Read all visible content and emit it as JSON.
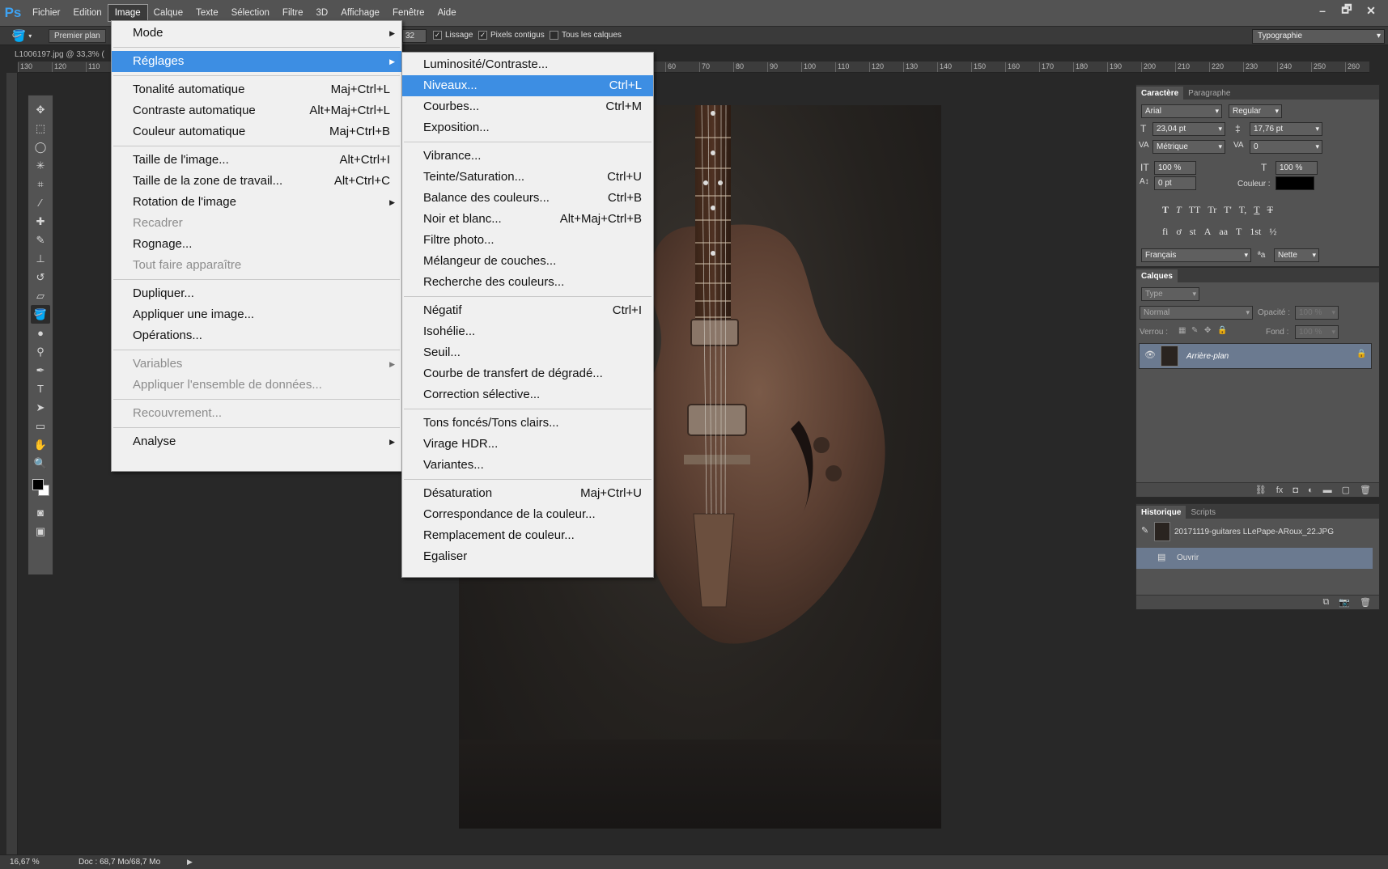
{
  "app": {
    "logo": "Ps",
    "menu": [
      "Fichier",
      "Edition",
      "Image",
      "Calque",
      "Texte",
      "Sélection",
      "Filtre",
      "3D",
      "Affichage",
      "Fenêtre",
      "Aide"
    ],
    "window_controls": [
      "–",
      "🗗",
      "✕"
    ]
  },
  "options": {
    "fill_source": "Premier plan",
    "tolerance": "32",
    "lissage": "Lissage",
    "pixels_contigus": "Pixels contigus",
    "tous_les_calques": "Tous les calques",
    "workspace": "Typographie"
  },
  "document": {
    "tab_title": "L1006197.jpg @ 33,3% (",
    "ruler_top": [
      "130",
      "120",
      "110",
      "60",
      "70",
      "80",
      "90",
      "100",
      "110",
      "120",
      "130",
      "140",
      "150",
      "160",
      "170",
      "180",
      "190",
      "200",
      "210",
      "220",
      "230",
      "240",
      "250",
      "260"
    ]
  },
  "image_menu": {
    "items": [
      {
        "label": "Mode",
        "shortcut": "",
        "submenu": true,
        "disabled": false
      },
      {
        "sep": true
      },
      {
        "label": "Réglages",
        "shortcut": "",
        "submenu": true,
        "disabled": false,
        "highlight": true
      },
      {
        "sep": true
      },
      {
        "label": "Tonalité automatique",
        "shortcut": "Maj+Ctrl+L"
      },
      {
        "label": "Contraste automatique",
        "shortcut": "Alt+Maj+Ctrl+L"
      },
      {
        "label": "Couleur automatique",
        "shortcut": "Maj+Ctrl+B"
      },
      {
        "sep": true
      },
      {
        "label": "Taille de l'image...",
        "shortcut": "Alt+Ctrl+I"
      },
      {
        "label": "Taille de la zone de travail...",
        "shortcut": "Alt+Ctrl+C"
      },
      {
        "label": "Rotation de l'image",
        "shortcut": "",
        "submenu": true
      },
      {
        "label": "Recadrer",
        "shortcut": "",
        "disabled": true
      },
      {
        "label": "Rognage...",
        "shortcut": ""
      },
      {
        "label": "Tout faire apparaître",
        "shortcut": "",
        "disabled": true
      },
      {
        "sep": true
      },
      {
        "label": "Dupliquer...",
        "shortcut": ""
      },
      {
        "label": "Appliquer une image...",
        "shortcut": ""
      },
      {
        "label": "Opérations...",
        "shortcut": ""
      },
      {
        "sep": true
      },
      {
        "label": "Variables",
        "shortcut": "",
        "submenu": true,
        "disabled": true
      },
      {
        "label": "Appliquer l'ensemble de données...",
        "shortcut": "",
        "disabled": true
      },
      {
        "sep": true
      },
      {
        "label": "Recouvrement...",
        "shortcut": "",
        "disabled": true
      },
      {
        "sep": true
      },
      {
        "label": "Analyse",
        "shortcut": "",
        "submenu": true
      }
    ]
  },
  "adjust_menu": {
    "items": [
      {
        "label": "Luminosité/Contraste...",
        "shortcut": ""
      },
      {
        "label": "Niveaux...",
        "shortcut": "Ctrl+L",
        "highlight": true
      },
      {
        "label": "Courbes...",
        "shortcut": "Ctrl+M"
      },
      {
        "label": "Exposition...",
        "shortcut": ""
      },
      {
        "sep": true
      },
      {
        "label": "Vibrance...",
        "shortcut": ""
      },
      {
        "label": "Teinte/Saturation...",
        "shortcut": "Ctrl+U"
      },
      {
        "label": "Balance des couleurs...",
        "shortcut": "Ctrl+B"
      },
      {
        "label": "Noir et blanc...",
        "shortcut": "Alt+Maj+Ctrl+B"
      },
      {
        "label": "Filtre photo...",
        "shortcut": ""
      },
      {
        "label": "Mélangeur de couches...",
        "shortcut": ""
      },
      {
        "label": "Recherche des couleurs...",
        "shortcut": ""
      },
      {
        "sep": true
      },
      {
        "label": "Négatif",
        "shortcut": "Ctrl+I"
      },
      {
        "label": "Isohélie...",
        "shortcut": ""
      },
      {
        "label": "Seuil...",
        "shortcut": ""
      },
      {
        "label": "Courbe de transfert de dégradé...",
        "shortcut": ""
      },
      {
        "label": "Correction sélective...",
        "shortcut": ""
      },
      {
        "sep": true
      },
      {
        "label": "Tons foncés/Tons clairs...",
        "shortcut": ""
      },
      {
        "label": "Virage HDR...",
        "shortcut": ""
      },
      {
        "label": "Variantes...",
        "shortcut": ""
      },
      {
        "sep": true
      },
      {
        "label": "Désaturation",
        "shortcut": "Maj+Ctrl+U"
      },
      {
        "label": "Correspondance de la couleur...",
        "shortcut": ""
      },
      {
        "label": "Remplacement de couleur...",
        "shortcut": ""
      },
      {
        "label": "Egaliser",
        "shortcut": ""
      }
    ]
  },
  "character": {
    "tab_active": "Caractère",
    "tab_other": "Paragraphe",
    "font": "Arial",
    "style": "Regular",
    "size": "23,04 pt",
    "leading": "17,76 pt",
    "kerning": "Métrique",
    "tracking": "0",
    "vscale": "100 %",
    "hscale": "100 %",
    "baseline": "0 pt",
    "color_label": "Couleur :",
    "language": "Français",
    "aa_symbol": "ªa",
    "antialias": "Nette",
    "style_buttons": [
      "T",
      "T",
      "TT",
      "Tr",
      "T'",
      "T,",
      "T",
      "T"
    ],
    "opentype_buttons": [
      "fi",
      "ơ",
      "st",
      "A",
      "aa",
      "T",
      "1st",
      "½"
    ]
  },
  "layers": {
    "tab": "Calques",
    "filter": "Type",
    "blend": "Normal",
    "opacity_label": "Opacité :",
    "opacity": "100 %",
    "lock_label": "Verrou :",
    "fill_label": "Fond :",
    "fill": "100 %",
    "layer_name": "Arrière-plan"
  },
  "history": {
    "tab_active": "Historique",
    "tab_other": "Scripts",
    "snapshot": "20171119-guitares LLePape-ARoux_22.JPG",
    "step": "Ouvrir"
  },
  "status": {
    "zoom": "16,67 %",
    "doc": "Doc : 68,7 Mo/68,7 Mo"
  },
  "colors": {
    "menu_highlight": "#3d8ee3",
    "ps_blue": "#3ea3f3"
  }
}
